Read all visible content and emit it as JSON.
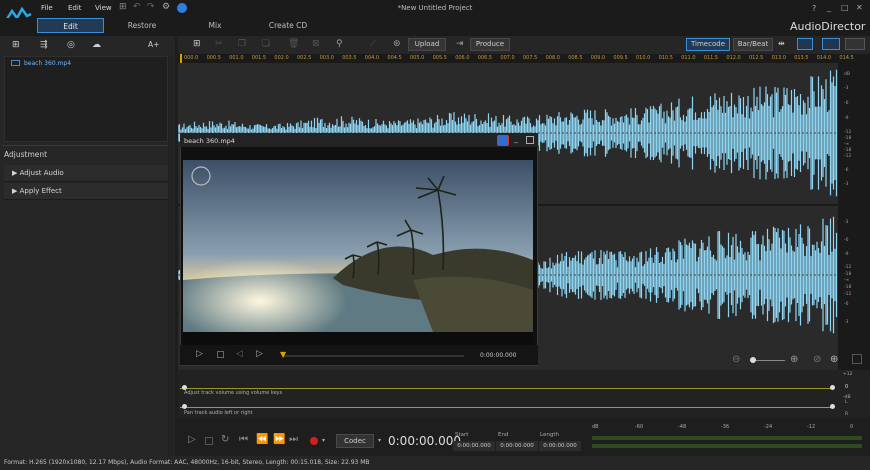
{
  "app": {
    "window_title": "*New Untitled Project",
    "name": "AudioDirector",
    "window_controls": [
      "?",
      "_",
      "□",
      "✕"
    ]
  },
  "menu": [
    "File",
    "Edit",
    "View"
  ],
  "modes": [
    "Edit",
    "Restore",
    "Mix",
    "Create CD"
  ],
  "left": {
    "add_label": "A+",
    "media_item": "beach 360.mp4",
    "adjustment_title": "Adjustment",
    "adjust_items": [
      "Adjust Audio",
      "Apply Effect"
    ]
  },
  "toolbar": {
    "upload": "Upload",
    "produce": "Produce",
    "timecode": "Timecode",
    "barbeat": "Bar/Beat"
  },
  "ruler": [
    "000.0",
    "000.5",
    "001.0",
    "001.5",
    "002.0",
    "002.5",
    "003.0",
    "003.5",
    "004.0",
    "004.5",
    "005.0",
    "005.5",
    "006.0",
    "006.5",
    "007.0",
    "007.5",
    "008.0",
    "008.5",
    "009.0",
    "009.5",
    "010.0",
    "010.5",
    "011.0",
    "011.5",
    "012.0",
    "012.5",
    "013.0",
    "013.5",
    "014.0",
    "014.5"
  ],
  "track_marker": "1",
  "vu_labels": [
    "dB",
    "-3",
    "-6",
    "-9",
    "-12",
    "-18",
    "-∞",
    "-18",
    "-12",
    "-6",
    "-3"
  ],
  "player": {
    "title": "beach 360.mp4",
    "time": "0:00:00.000"
  },
  "lanes": {
    "volume": "Adjust track volume using volume keys",
    "pan": "Pan track audio left or right",
    "vol_marks": [
      "+12",
      "0",
      "-dB"
    ],
    "pan_marks": [
      "L",
      "R"
    ]
  },
  "transport": {
    "codec": "Codec",
    "time": "0:00:00.000",
    "start_label": "Start",
    "end_label": "End",
    "length_label": "Length",
    "start": "0:00:00.000",
    "end": "0:00:00.000",
    "length": "0:00:00.000",
    "meter_labels": [
      "dB",
      "-60",
      "-48",
      "-36",
      "-24",
      "-12",
      "0"
    ]
  },
  "status": "Format: H.265 (1920x1080, 12.17 Mbps), Audio Format: AAC, 48000Hz, 16-bit, Stereo, Length: 00:15.018, Size: 22.93 MB",
  "colors": {
    "wave": "#8fd6f5",
    "accent": "#3a8fd8",
    "ruler": "#c99a2c"
  }
}
